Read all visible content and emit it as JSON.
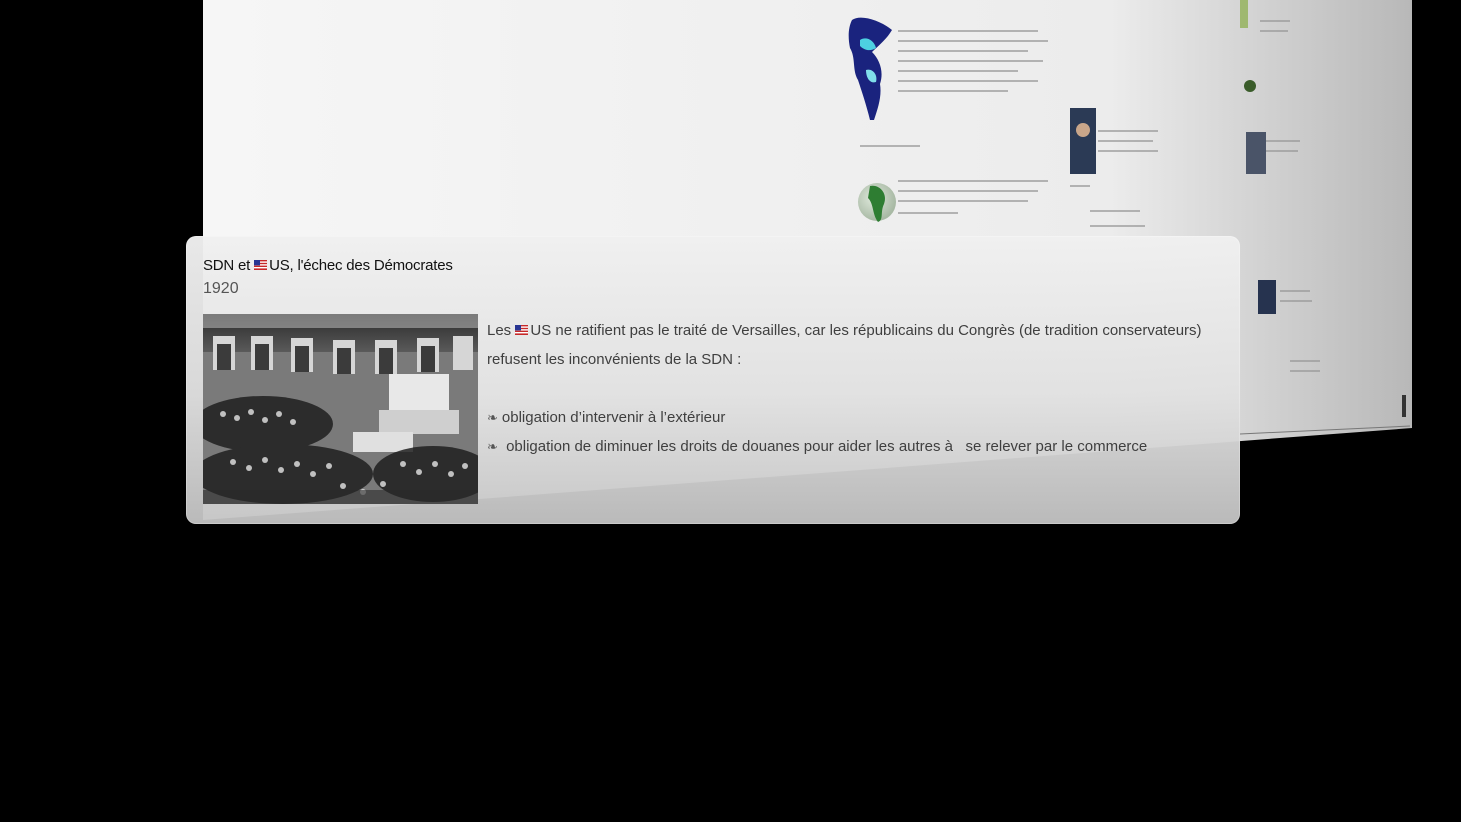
{
  "card": {
    "title_prefix": "SDN et ",
    "title_suffix": "US, l'échec des Démocrates",
    "year": "1920",
    "intro_prefix": "Les ",
    "intro_suffix": "US ne ratifient pas le traité de Versailles, car les républicains du Congrès (de tradition conservateurs) refusent les inconvénients de la SDN :",
    "bullets": [
      "obligation d’intervenir à l’extérieur",
      " obligation de diminuer les droits de douanes pour aider les autres à   se relever par le commerce"
    ],
    "bullet_mark": "❧"
  },
  "icons": {
    "flag": "us-flag-icon",
    "photo": "congress-chamber-photo"
  },
  "colors": {
    "background": "#000000",
    "card": "#ececec",
    "title": "#111111",
    "text": "#3f3f3f"
  }
}
